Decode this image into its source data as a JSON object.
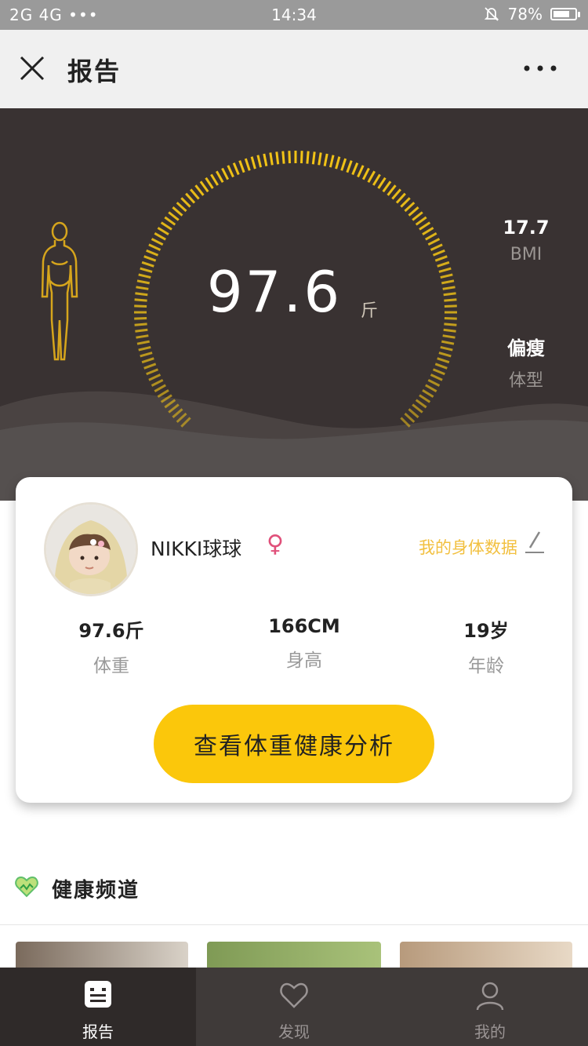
{
  "status_bar": {
    "signal_text": "2G 4G",
    "dots": "•••",
    "time": "14:34",
    "mute_icon": "bell-off-icon",
    "battery": "78%",
    "battery_level": 0.78
  },
  "app_bar": {
    "title": "报告",
    "close_icon": "close-icon",
    "more_icon": "more-dots-icon"
  },
  "hero": {
    "weight": "97.6",
    "unit": "斤",
    "bmi_value": "17.7",
    "bmi_label": "BMI",
    "body_type_value": "偏瘦",
    "body_type_label": "体型",
    "figure_icon": "female-body-icon",
    "accent_color": "#f2c316",
    "background_color": "#393232"
  },
  "profile": {
    "name": "NIKKI球球",
    "gender_symbol": "♀",
    "my_data_link": "我的身体数据",
    "edit_icon": "pencil-icon",
    "metrics": [
      {
        "value": "97.6斤",
        "label": "体重"
      },
      {
        "value": "166CM",
        "label": "身高"
      },
      {
        "value": "19岁",
        "label": "年龄"
      }
    ],
    "cta_label": "查看体重健康分析",
    "cta_color": "#fbc70b"
  },
  "health_channel": {
    "title": "健康频道",
    "icon": "heart-icon"
  },
  "tab_bar": {
    "tabs": [
      {
        "label": "报告",
        "icon": "report-icon",
        "active": true
      },
      {
        "label": "发现",
        "icon": "heart-outline-icon",
        "active": false
      },
      {
        "label": "我的",
        "icon": "user-icon",
        "active": false
      }
    ]
  }
}
